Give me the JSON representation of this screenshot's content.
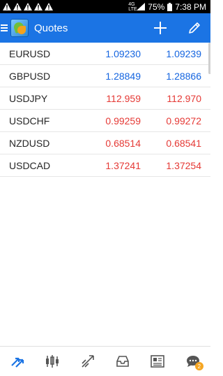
{
  "status_bar": {
    "battery": "75%",
    "time": "7:38 PM",
    "network_badge": "4G\nLTE"
  },
  "app_bar": {
    "title": "Quotes"
  },
  "quotes": [
    {
      "symbol": "EURUSD",
      "bid": "1.09230",
      "ask": "1.09239",
      "direction": "up"
    },
    {
      "symbol": "GBPUSD",
      "bid": "1.28849",
      "ask": "1.28866",
      "direction": "up"
    },
    {
      "symbol": "USDJPY",
      "bid": "112.959",
      "ask": "112.970",
      "direction": "down"
    },
    {
      "symbol": "USDCHF",
      "bid": "0.99259",
      "ask": "0.99272",
      "direction": "down"
    },
    {
      "symbol": "NZDUSD",
      "bid": "0.68514",
      "ask": "0.68541",
      "direction": "down"
    },
    {
      "symbol": "USDCAD",
      "bid": "1.37241",
      "ask": "1.37254",
      "direction": "down"
    }
  ],
  "bottom_nav": {
    "items": [
      "quotes-icon",
      "chart-icon",
      "trade-icon",
      "history-icon",
      "news-icon",
      "chat-icon"
    ],
    "chat_badge": "2"
  },
  "colors": {
    "accent": "#1b74e4",
    "up": "#1565e0",
    "down": "#e53935",
    "badge": "#f5a623"
  }
}
